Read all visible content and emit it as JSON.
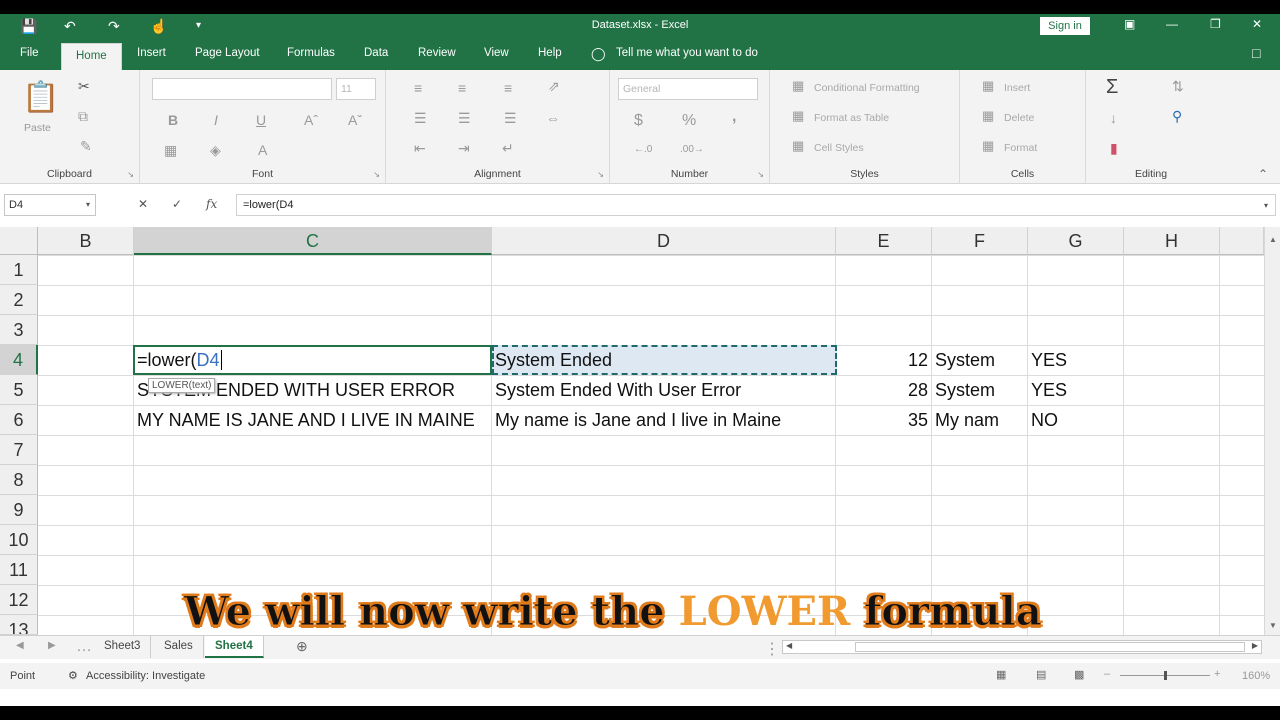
{
  "window": {
    "title": "Dataset.xlsx  -  Excel",
    "signin_label": "Sign in"
  },
  "tabs": [
    "File",
    "Home",
    "Insert",
    "Page Layout",
    "Formulas",
    "Data",
    "Review",
    "View",
    "Help"
  ],
  "tell_me": "Tell me what you want to do",
  "ribbon": {
    "clipboard": {
      "label": "Clipboard",
      "paste": "Paste"
    },
    "font": {
      "label": "Font",
      "size": "11",
      "bold": "B",
      "italic": "I",
      "underline": "U"
    },
    "alignment": {
      "label": "Alignment"
    },
    "number": {
      "label": "Number",
      "format": "General",
      "currency": "$",
      "percent": "%",
      "comma": ","
    },
    "styles": {
      "label": "Styles",
      "conditional": "Conditional Formatting",
      "format_table": "Format as Table",
      "cell_styles": "Cell Styles"
    },
    "cells": {
      "label": "Cells",
      "insert": "Insert",
      "delete": "Delete",
      "format": "Format"
    },
    "editing": {
      "label": "Editing"
    }
  },
  "formula_bar": {
    "name_box": "D4",
    "formula": "=lower(D4"
  },
  "columns": [
    "B",
    "C",
    "D",
    "E",
    "F",
    "G",
    "H"
  ],
  "rows": [
    "1",
    "2",
    "3",
    "4",
    "5",
    "6",
    "7",
    "8",
    "9",
    "10",
    "11",
    "12",
    "13"
  ],
  "cells": {
    "c4_prefix": "=lower(",
    "c4_ref": "D4",
    "c5": "SYSTEM ENDED WITH USER ERROR",
    "c6": "MY NAME IS JANE AND I LIVE IN MAINE",
    "d4": "System Ended",
    "d5": "System Ended With User Error",
    "d6": "My name is Jane and I live in Maine",
    "e4": "12",
    "e5": "28",
    "e6": "35",
    "f4": "System",
    "f5": "System",
    "f6": "My nam",
    "g4": "YES",
    "g5": "YES",
    "g6": "NO"
  },
  "tooltip": {
    "fn": "LOWER(",
    "arg": "text",
    "close": ")"
  },
  "sheets": [
    "Sheet3",
    "Sales",
    "Sheet4"
  ],
  "active_sheet": "Sheet4",
  "status": {
    "mode": "Point",
    "accessibility": "Accessibility: Investigate",
    "zoom": "160%"
  },
  "caption": {
    "before": "We will now write the ",
    "highlight": "LOWER",
    "after": " formula"
  },
  "colors": {
    "excel_green": "#217346",
    "caption_orange": "#e07b1c"
  }
}
